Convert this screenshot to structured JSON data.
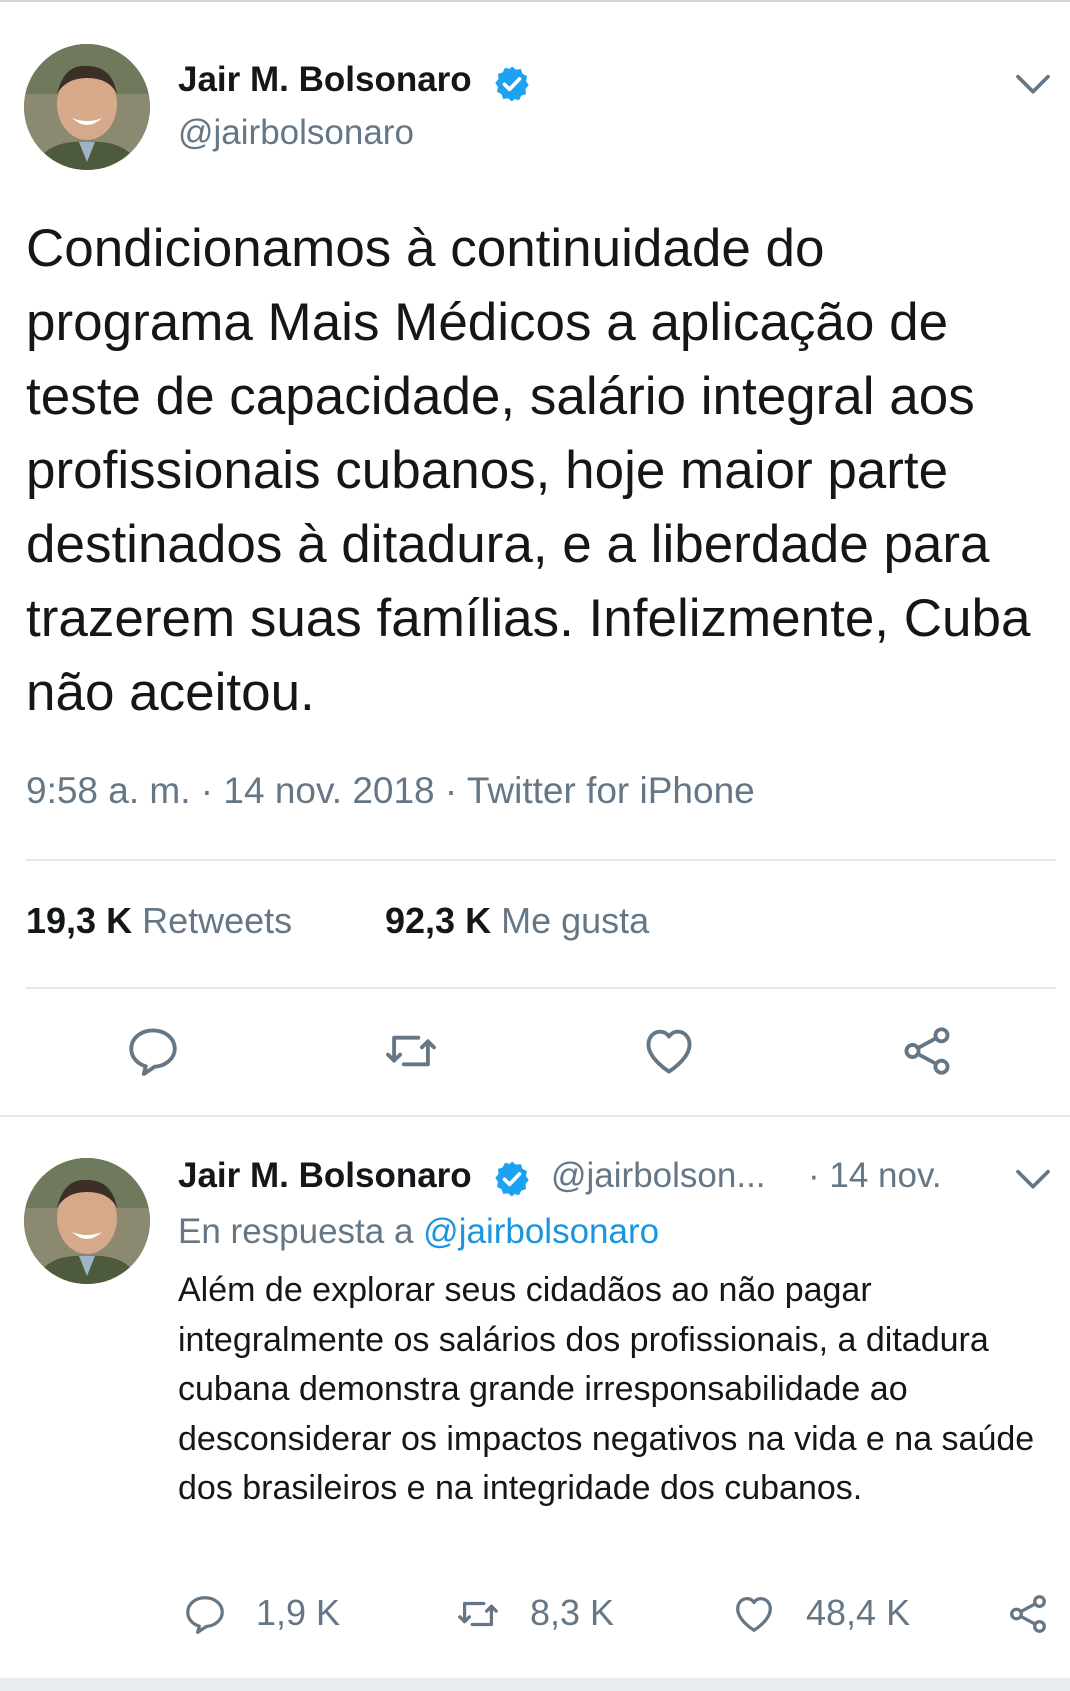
{
  "tweet": {
    "author_name": "Jair M. Bolsonaro",
    "handle": "@jairbolsonaro",
    "text": "Condicionamos à continuidade do programa Mais Médicos a aplicação de teste de capacidade, salário integral aos profissionais cubanos, hoje maior parte destinados à ditadura, e a liberdade para trazerem suas famílias. Infelizmente, Cuba não aceitou.",
    "meta": "9:58 a. m. · 14 nov. 2018 · Twitter for iPhone",
    "retweets_count": "19,3 K",
    "retweets_label": "Retweets",
    "likes_count": "92,3 K",
    "likes_label": "Me gusta"
  },
  "reply": {
    "author_name": "Jair M. Bolsonaro",
    "handle": "@jairbolson...",
    "date": "· 14 nov.",
    "reply_prefix": "En respuesta a",
    "reply_handle": "@jairbolsonaro",
    "text": "Além de explorar seus cidadãos ao não pagar integralmente os salários dos profissionais, a ditadura cubana demonstra grande irresponsabilidade ao desconsiderar os impactos negativos na vida e na saúde dos brasileiros e na integridade dos cubanos.",
    "reply_count": "1,9 K",
    "retweet_count": "8,3 K",
    "like_count": "48,4 K"
  },
  "colors": {
    "text": "#14171a",
    "secondary": "#657786",
    "link": "#1b95e0",
    "verified": "#1da1f2",
    "divider": "#e1e8ed"
  },
  "icons": [
    "verified-badge-icon",
    "chevron-down-icon",
    "reply-icon",
    "retweet-icon",
    "heart-icon",
    "share-icon"
  ]
}
